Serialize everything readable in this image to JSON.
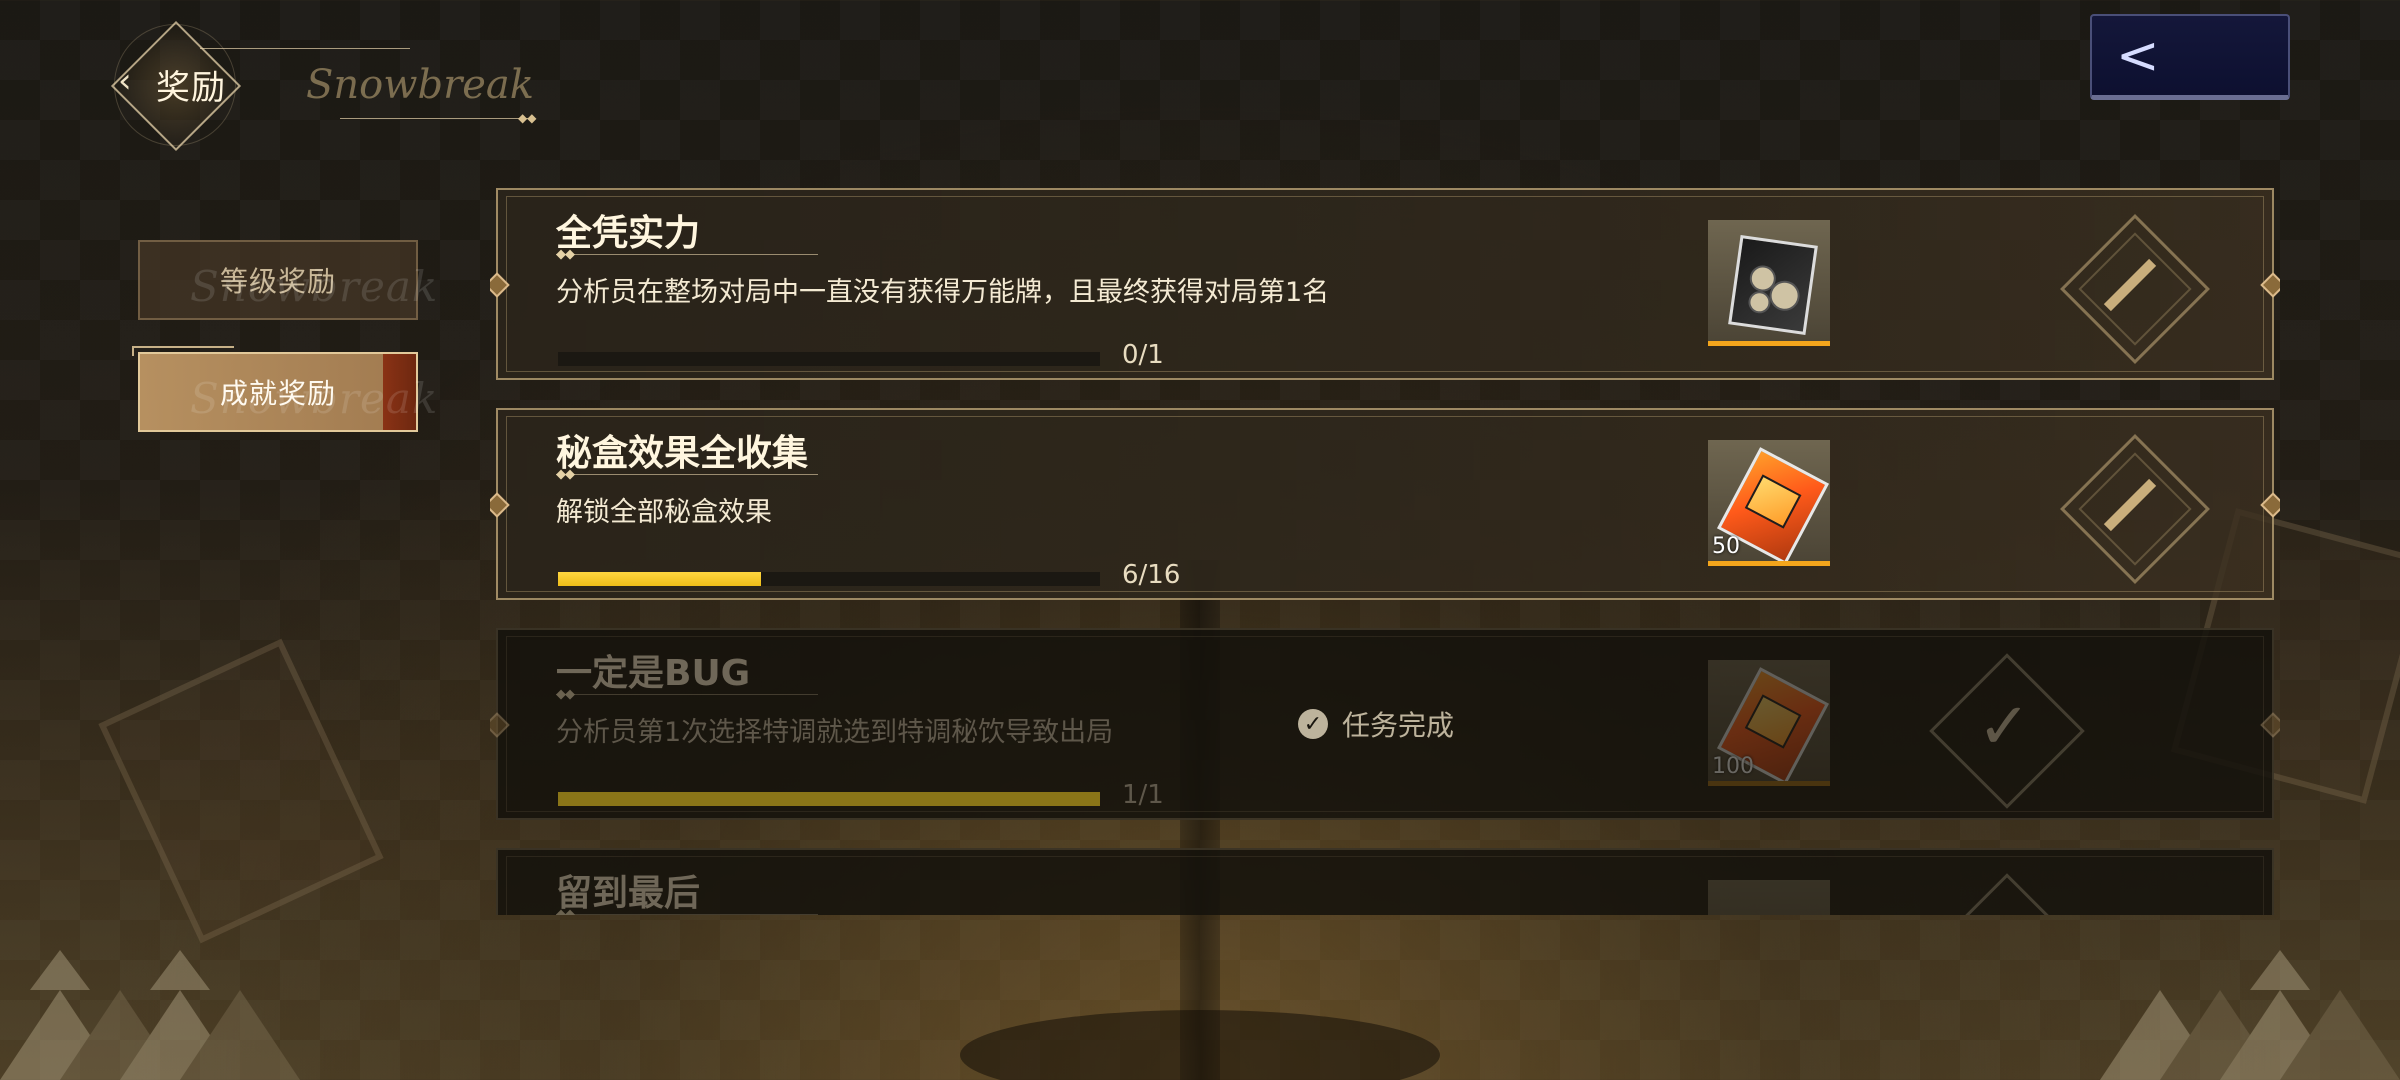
{
  "header": {
    "title": "奖励",
    "back_glyph": "‹",
    "script_text": "Snowbreak",
    "close_glyph": "<"
  },
  "tabs": [
    {
      "label": "等级奖励",
      "selected": false
    },
    {
      "label": "成就奖励",
      "selected": true
    }
  ],
  "tab_script": "Snowbreak",
  "achievements": [
    {
      "title": "全凭实力",
      "description": "分析员在整场对局中一直没有获得万能牌，且最终获得对局第1名",
      "progress_text": "0/1",
      "progress": 0.0,
      "reward_qty": "",
      "status": "in_progress"
    },
    {
      "title": "秘盒效果全收集",
      "description": "解锁全部秘盒效果",
      "progress_text": "6/16",
      "progress": 0.375,
      "reward_qty": "50",
      "status": "in_progress"
    },
    {
      "title": "一定是BUG",
      "description": "分析员第1次选择特调就选到特调秘饮导致出局",
      "progress_text": "1/1",
      "progress": 1.0,
      "reward_qty": "100",
      "status": "completed",
      "status_label": "任务完成"
    },
    {
      "title": "留到最后",
      "description": "",
      "progress_text": "",
      "progress": 0.0,
      "reward_qty": "",
      "status": "completed"
    }
  ],
  "colors": {
    "accent_gold": "#dab98a",
    "progress_yellow": "#ffd640",
    "reward_rarity": "#f3a51c",
    "back_button": "#14173a",
    "selected_tab": "#be9664"
  },
  "icons": {
    "back": "chevron-left-icon",
    "claim": "claim-slash-icon",
    "completed": "check-icon"
  }
}
